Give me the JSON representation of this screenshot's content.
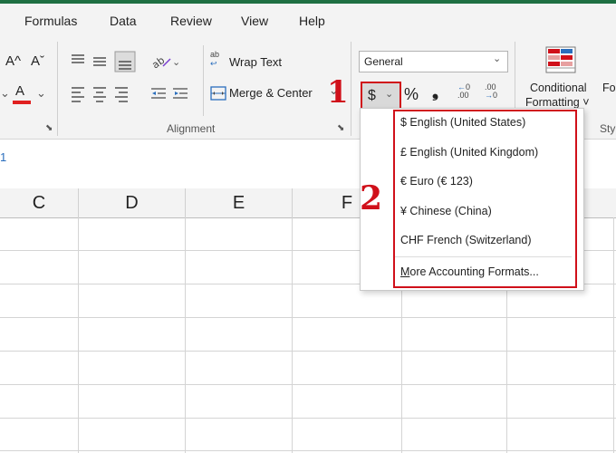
{
  "menu_tabs": [
    "Formulas",
    "Data",
    "Review",
    "View",
    "Help"
  ],
  "font_group": {
    "increase_font": "A^",
    "decrease_font": "Aˇ",
    "font_color_letter": "A"
  },
  "alignment": {
    "wrap_text": "Wrap Text",
    "merge_center": "Merge & Center",
    "group_label": "Alignment",
    "ab_glyph": "ab"
  },
  "number": {
    "format_value": "General",
    "accounting_symbol": "$",
    "percent_symbol": "%",
    "comma_symbol": "̦,",
    "increase_decimal": ".00",
    "decrease_decimal": ".00"
  },
  "styles": {
    "conditional_formatting_line1": "Conditional",
    "conditional_formatting_line2": "Formatting ˅",
    "format_table_partial": "Fo",
    "group_label_partial": "Sty"
  },
  "formula_bar": {
    "cell_ref_partial": "1"
  },
  "columns": [
    "C",
    "D",
    "E",
    "F"
  ],
  "accounting_menu": {
    "options": [
      "$ English (United States)",
      "£ English (United Kingdom)",
      "€ Euro (€ 123)",
      "¥ Chinese (China)",
      "CHF French (Switzerland)"
    ],
    "more": "More Accounting Formats..."
  },
  "callouts": {
    "one": "1",
    "two": "2"
  },
  "colors": {
    "callout_red": "#d0101a",
    "excel_green": "#1e6f42",
    "font_color_underline": "#e02020"
  }
}
